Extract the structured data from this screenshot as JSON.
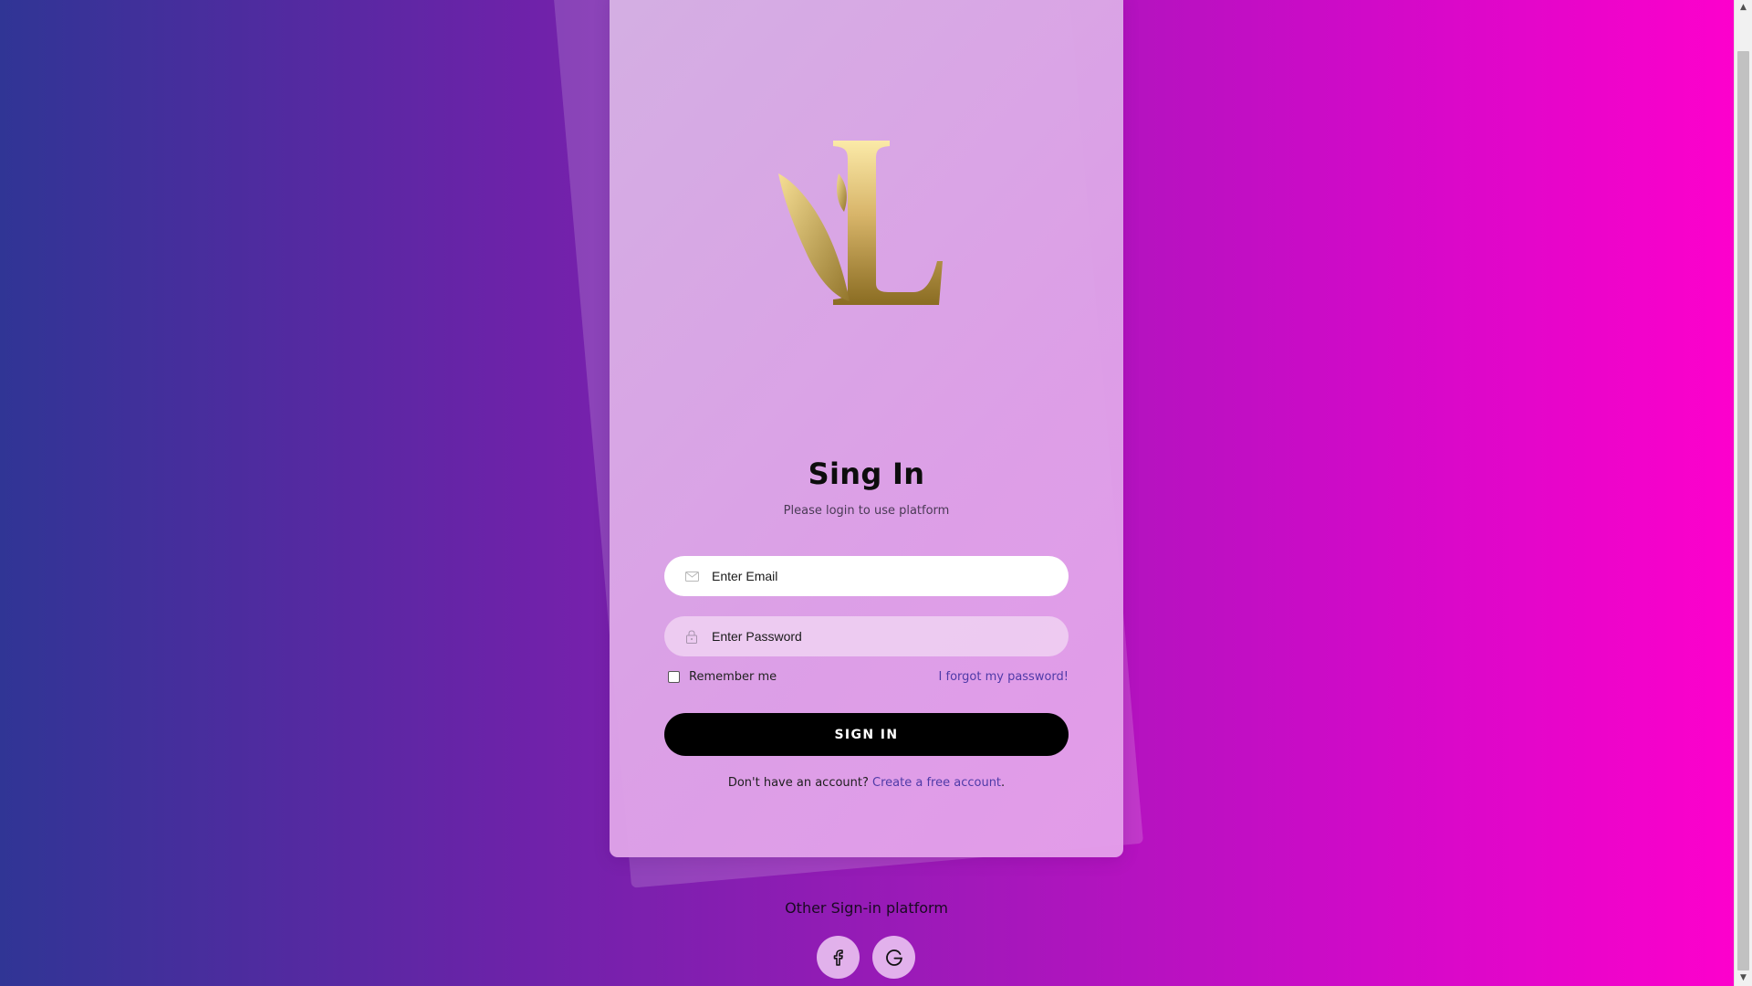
{
  "card": {
    "title": "Sing In",
    "subtitle": "Please login to use platform"
  },
  "form": {
    "email_placeholder": "Enter Email",
    "password_placeholder": "Enter Password",
    "remember_label": "Remember me",
    "remember_checked": false,
    "forgot_label": "I forgot my password!",
    "submit_label": "SIGN IN",
    "signup_prompt": "Don't have an account?",
    "signup_link": "Create a free account",
    "signup_suffix": "."
  },
  "social": {
    "heading": "Other Sign-in platform",
    "providers": [
      {
        "name": "facebook",
        "icon": "facebook-icon"
      },
      {
        "name": "google",
        "icon": "google-icon"
      }
    ]
  },
  "colors": {
    "gradient_left": "#303595",
    "gradient_right": "#ff00cc",
    "logo_gold_light": "#f7e3a0",
    "logo_gold_dark": "#8a6c22",
    "link": "#4f3aa8",
    "button": "#000000"
  },
  "icons": {
    "logo": "leaf-letter-l-logo",
    "email": "envelope-icon",
    "password": "lock-icon"
  }
}
